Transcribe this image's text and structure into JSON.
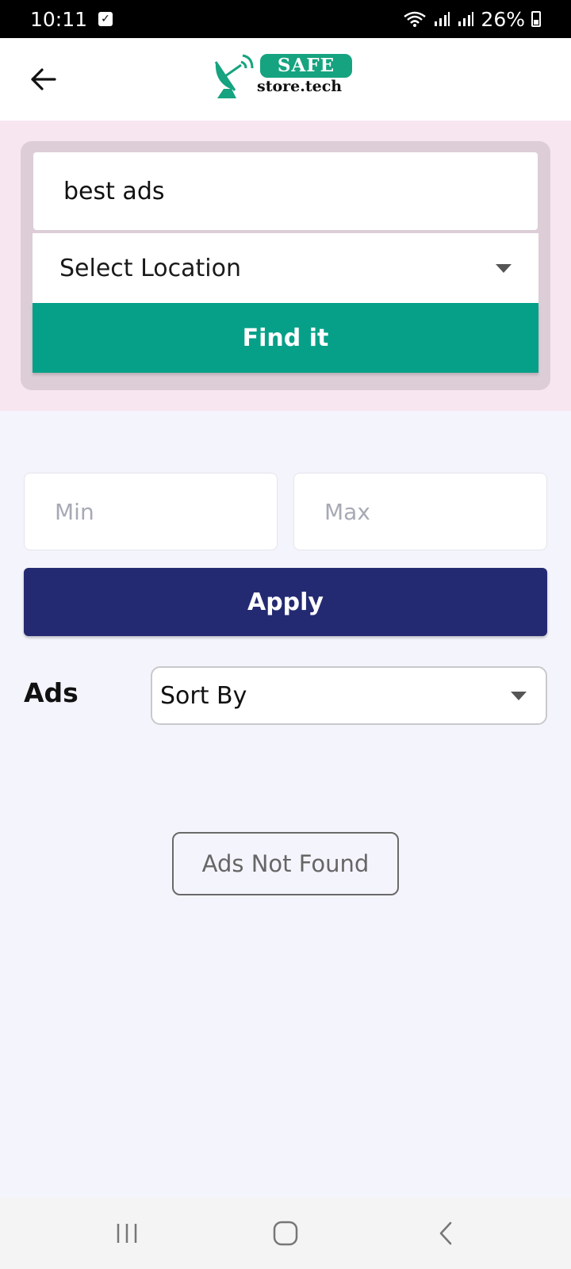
{
  "status_bar": {
    "time": "10:11",
    "battery": "26%"
  },
  "header": {
    "logo_top": "SAFE",
    "logo_bottom": "store.tech",
    "brand_color": "#16a37f"
  },
  "search": {
    "keyword_value": "best ads",
    "location_value": "Select Location",
    "find_label": "Find it",
    "find_color": "#06a088"
  },
  "price_filter": {
    "min_placeholder": "Min",
    "max_placeholder": "Max",
    "apply_label": "Apply",
    "apply_color": "#242a72"
  },
  "ads": {
    "label": "Ads",
    "sort_value": "Sort By",
    "empty_message": "Ads Not Found"
  },
  "icons": {
    "back": "arrow-left-icon",
    "recent": "recent-apps-icon",
    "home": "home-icon",
    "nav_back": "chevron-left-icon"
  }
}
